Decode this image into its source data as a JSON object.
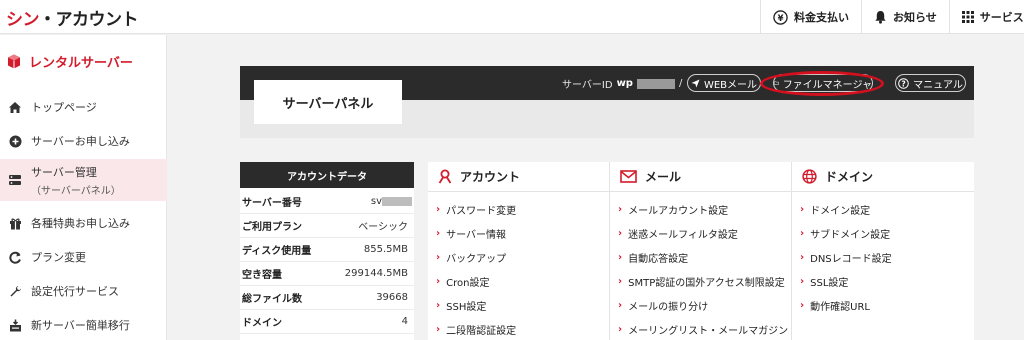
{
  "header": {
    "logo_accent": "シン",
    "logo_rest": "・アカウント",
    "payment": "料金支払い",
    "notice": "お知らせ",
    "services": "サービス管"
  },
  "sidebar": {
    "brand": "レンタルサーバー",
    "items": [
      {
        "label": "トップページ",
        "icon": "home-icon"
      },
      {
        "label": "サーバーお申し込み",
        "icon": "plus-circle-icon"
      },
      {
        "label": "サーバー管理",
        "sub": "（サーバーパネル）",
        "icon": "server-icon",
        "active": true
      },
      {
        "label": "各種特典お申し込み",
        "icon": "gift-icon"
      },
      {
        "label": "プラン変更",
        "icon": "refresh-icon"
      },
      {
        "label": "設定代行サービス",
        "icon": "wrench-icon"
      },
      {
        "label": "新サーバー簡単移行",
        "icon": "migrate-icon"
      }
    ]
  },
  "panel": {
    "title": "サーバーパネル",
    "server_id_label": "サーバーID",
    "server_id_value": "wp",
    "separator": "/",
    "web_mail": "WEBメール",
    "file_manager": "ファイルマネージャ",
    "manual": "マニュアル"
  },
  "account_data": {
    "title": "アカウントデータ",
    "rows": [
      {
        "key": "サーバー番号",
        "value": "sv"
      },
      {
        "key": "ご利用プラン",
        "value": "ベーシック"
      },
      {
        "key": "ディスク使用量",
        "value": "855.5MB"
      },
      {
        "key": "空き容量",
        "value": "299144.5MB"
      },
      {
        "key": "総ファイル数",
        "value": "39668"
      },
      {
        "key": "ドメイン",
        "value": "4"
      }
    ]
  },
  "columns": [
    {
      "title": "アカウント",
      "icon": "person-icon",
      "links": [
        "パスワード変更",
        "サーバー情報",
        "バックアップ",
        "Cron設定",
        "SSH設定",
        "二段階認証設定"
      ]
    },
    {
      "title": "メール",
      "icon": "envelope-icon",
      "links": [
        "メールアカウント設定",
        "迷惑メールフィルタ設定",
        "自動応答設定",
        "SMTP認証の国外アクセス制限設定",
        "メールの振り分け",
        "メーリングリスト・メールマガジン"
      ]
    },
    {
      "title": "ドメイン",
      "icon": "globe-icon",
      "links": [
        "ドメイン設定",
        "サブドメイン設定",
        "DNSレコード設定",
        "SSL設定",
        "動作確認URL"
      ]
    }
  ],
  "colors": {
    "accent": "#d21c2c",
    "dark": "#2b2b2b",
    "highlight_oval": "#d4101f"
  }
}
